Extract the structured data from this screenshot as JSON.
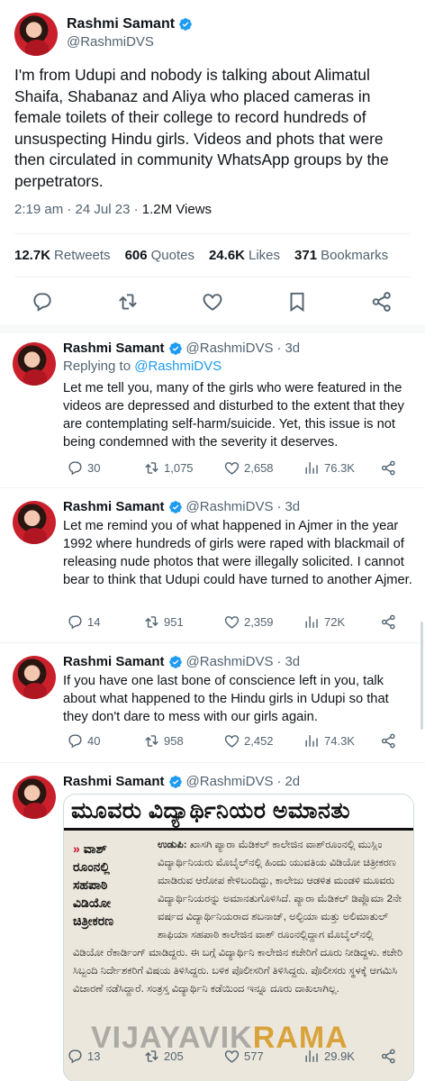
{
  "main": {
    "name": "Rashmi Samant",
    "handle": "@RashmiDVS",
    "text": "I'm from Udupi and nobody is talking about Alimatul Shaifa, Shabanaz and Aliya who placed cameras in female toilets of their college to record hundreds of unsuspecting Hindu girls. Videos and phots that were then circulated in community WhatsApp groups by the perpetrators.",
    "time": "2:19 am",
    "date": "24 Jul 23",
    "views_count": "1.2M",
    "views_label": "Views",
    "stats": [
      {
        "num": "12.7K",
        "label": "Retweets"
      },
      {
        "num": "606",
        "label": "Quotes"
      },
      {
        "num": "24.6K",
        "label": "Likes"
      },
      {
        "num": "371",
        "label": "Bookmarks"
      }
    ],
    "action_icons": [
      "reply-icon",
      "retweet-icon",
      "like-icon",
      "bookmark-icon",
      "share-icon"
    ]
  },
  "replies": [
    {
      "name": "Rashmi Samant",
      "handle": "@RashmiDVS",
      "age": "3d",
      "replying_prefix": "Replying to",
      "replying_to": "@RashmiDVS",
      "text": "Let me tell you, many of the girls who were featured in the videos are depressed and disturbed to the extent that they are contemplating self-harm/suicide. Yet, this issue is not being condemned with the severity it deserves.",
      "replies": "30",
      "retweets": "1,075",
      "likes": "2,658",
      "views": "76.3K"
    },
    {
      "name": "Rashmi Samant",
      "handle": "@RashmiDVS",
      "age": "3d",
      "text": "Let me remind you of what happened in Ajmer in the year 1992 where hundreds of girls were raped with blackmail of releasing nude photos that were illegally solicited. I cannot bear to think that Udupi could have turned to another Ajmer.",
      "replies": "14",
      "retweets": "951",
      "likes": "2,359",
      "views": "72K"
    },
    {
      "name": "Rashmi Samant",
      "handle": "@RashmiDVS",
      "age": "3d",
      "text": "If you have one last bone of conscience left in you, talk about what happened to the Hindu girls in Udupi so that they don't dare to mess with our girls again.",
      "replies": "40",
      "retweets": "958",
      "likes": "2,452",
      "views": "74.3K"
    },
    {
      "name": "Rashmi Samant",
      "handle": "@RashmiDVS",
      "age": "2d",
      "media": {
        "headline": "ಮೂವರು ವಿದ್ಯಾರ್ಥಿನಿಯರ ಅಮಾನತು",
        "dateline": "ಉಡುಪಿ:",
        "side_box_lines": [
          "ವಾಶ್",
          "ರೂಂನಲ್ಲಿ",
          "ಸಹಪಾಠಿ",
          "ವಿಡಿಯೋ",
          "ಚಿತ್ರೀಕರಣ"
        ],
        "body": "ಖಾಸಗಿ ಪ್ಯಾರಾ ಮೆಡಿಕಲ್ ಕಾಲೇಜಿನ ವಾಶ್‌ರೂಂನಲ್ಲಿ ಮುಸ್ಲಿಂ ವಿದ್ಯಾರ್ಥಿನಿಯರು ಮೊಬೈಲ್‌ನಲ್ಲಿ ಹಿಂದು ಯುವತಿಯ ವಿಡಿಯೋ ಚಿತ್ರೀಕರಣ ಮಾಡಿರುವ ಆರೋಪ ಕೇಳಿಬಂದಿದ್ದು, ಕಾಲೇಜು ಆಡಳಿತ ಮಂಡಳಿ ಮೂವರು ವಿದ್ಯಾರ್ಥಿನಿಯರನ್ನು ಅಮಾನತುಗೊಳಿಸಿದೆ. ಪ್ಯಾರಾ ಮೆಡಿಕಲ್ ಡಿಪ್ಲೊಮಾ 2ನೇ ವರ್ಷದ ವಿದ್ಯಾರ್ಥಿನಿಯರಾದ ಶಬನಾಜ್, ಅಲ್ಫಿಯಾ ಮತ್ತು ಅಲಿಮಾತುಲ್ ಶಾಫಿಯಾ ಸಹಪಾಠಿ ಕಾಲೇಜಿನ ವಾಶ್ ರೂಂನಲ್ಲಿದ್ದಾಗ ಮೊಬೈಲ್‌ನಲ್ಲಿ ವಿಡಿಯೋ ರೆಕಾರ್ಡಿಂಗ್ ಮಾಡಿದ್ದರು. ಈ ಬಗ್ಗೆ ವಿದ್ಯಾರ್ಥಿನಿ ಕಾಲೇಜಿನ ಕಚೇರಿಗೆ ದೂರು ನೀಡಿದ್ದಳು. ಕಚೇರಿ ಸಿಬ್ಬಂದಿ ನಿರ್ದೇಶಕರಿಗೆ ವಿಷಯ ತಿಳಿಸಿದ್ದರು. ಬಳಿಕ ಪೊಲೀಸರಿಗೆ ತಿಳಿಸಿದ್ದರು. ಪೊಲೀಸರು ಸ್ಥಳಕ್ಕೆ ಆಗಮಿಸಿ ವಿಚಾರಣೆ ನಡೆಸಿದ್ದಾರೆ. ಸಂತ್ರಸ್ತ ವಿದ್ಯಾರ್ಥಿನಿ ಕಡೆಯಿಂದ ಇನ್ನೂ ದೂರು ದಾಖಲಾಗಿಲ್ಲ.",
        "watermark_a": "VIJAYAVIK",
        "watermark_b": "RAMA"
      },
      "replies": "13",
      "retweets": "205",
      "likes": "577",
      "views": "29.9K"
    }
  ],
  "colors": {
    "accent": "#1d9bf0",
    "text": "#0f1419",
    "secondary": "#536471",
    "divider": "#eff3f4"
  }
}
